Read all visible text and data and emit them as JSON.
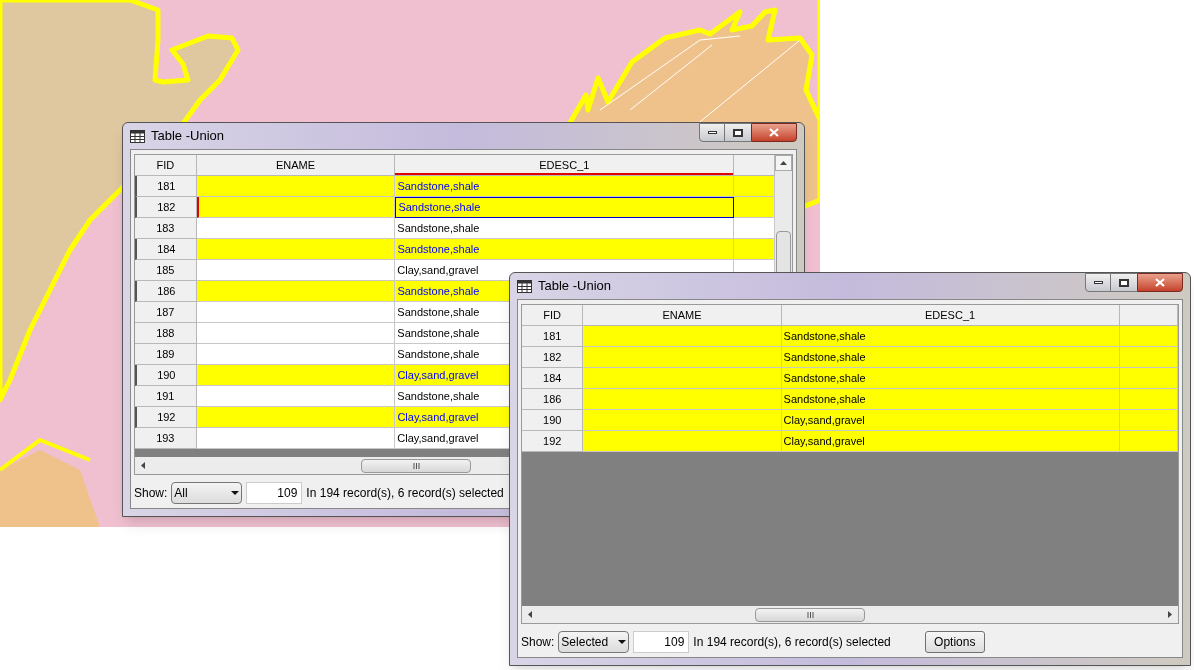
{
  "windows": [
    {
      "title": "Table -Union",
      "selected_text_blue": true,
      "columns": [
        {
          "label": "FID",
          "sorted": false
        },
        {
          "label": "ENAME",
          "sorted": false
        },
        {
          "label": "EDESC_1",
          "sorted": true
        }
      ],
      "rows": [
        {
          "fid": "181",
          "edesc_1": "Sandstone,shale",
          "selected": true,
          "current": false
        },
        {
          "fid": "182",
          "edesc_1": "Sandstone,shale",
          "selected": true,
          "current": true
        },
        {
          "fid": "183",
          "edesc_1": "Sandstone,shale",
          "selected": false,
          "current": false
        },
        {
          "fid": "184",
          "edesc_1": "Sandstone,shale",
          "selected": true,
          "current": false
        },
        {
          "fid": "185",
          "edesc_1": "Clay,sand,gravel",
          "selected": false,
          "current": false
        },
        {
          "fid": "186",
          "edesc_1": "Sandstone,shale",
          "selected": true,
          "current": false
        },
        {
          "fid": "187",
          "edesc_1": "Sandstone,shale",
          "selected": false,
          "current": false
        },
        {
          "fid": "188",
          "edesc_1": "Sandstone,shale",
          "selected": false,
          "current": false
        },
        {
          "fid": "189",
          "edesc_1": "Sandstone,shale",
          "selected": false,
          "current": false
        },
        {
          "fid": "190",
          "edesc_1": "Clay,sand,gravel",
          "selected": true,
          "current": false
        },
        {
          "fid": "191",
          "edesc_1": "Sandstone,shale",
          "selected": false,
          "current": false
        },
        {
          "fid": "192",
          "edesc_1": "Clay,sand,gravel",
          "selected": true,
          "current": false
        },
        {
          "fid": "193",
          "edesc_1": "Clay,sand,gravel",
          "selected": false,
          "current": false
        }
      ],
      "footer": {
        "show_label": "Show:",
        "show_value": "All",
        "record_field": "109",
        "status": "In 194 record(s), 6 record(s) selected"
      }
    },
    {
      "title": "Table -Union",
      "selected_text_blue": false,
      "columns": [
        {
          "label": "FID",
          "sorted": false
        },
        {
          "label": "ENAME",
          "sorted": false
        },
        {
          "label": "EDESC_1",
          "sorted": false
        }
      ],
      "rows": [
        {
          "fid": "181",
          "edesc_1": "Sandstone,shale",
          "selected": true,
          "current": false
        },
        {
          "fid": "182",
          "edesc_1": "Sandstone,shale",
          "selected": true,
          "current": false
        },
        {
          "fid": "184",
          "edesc_1": "Sandstone,shale",
          "selected": true,
          "current": false
        },
        {
          "fid": "186",
          "edesc_1": "Sandstone,shale",
          "selected": true,
          "current": false
        },
        {
          "fid": "190",
          "edesc_1": "Clay,sand,gravel",
          "selected": true,
          "current": false
        },
        {
          "fid": "192",
          "edesc_1": "Clay,sand,gravel",
          "selected": true,
          "current": false
        }
      ],
      "footer": {
        "show_label": "Show:",
        "show_value": "Selected",
        "record_field": "109",
        "status": "In 194 record(s), 6 record(s) selected",
        "options_button": "Options"
      }
    }
  ]
}
